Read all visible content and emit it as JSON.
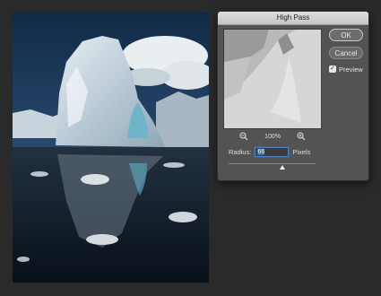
{
  "dialog": {
    "title": "High Pass",
    "ok_label": "OK",
    "cancel_label": "Cancel",
    "preview_label": "Preview",
    "preview_checked": true,
    "zoom_level": "100%",
    "radius_label": "Radius:",
    "radius_value": "66",
    "unit_label": "Pixels",
    "radius_slider_fraction": 0.62
  },
  "icons": {
    "zoom_out": "zoom-out-icon",
    "zoom_in": "zoom-in-icon",
    "check": "checkmark-icon"
  },
  "colors": {
    "dialog_bg": "#535353",
    "selection": "#3d6fb0"
  }
}
